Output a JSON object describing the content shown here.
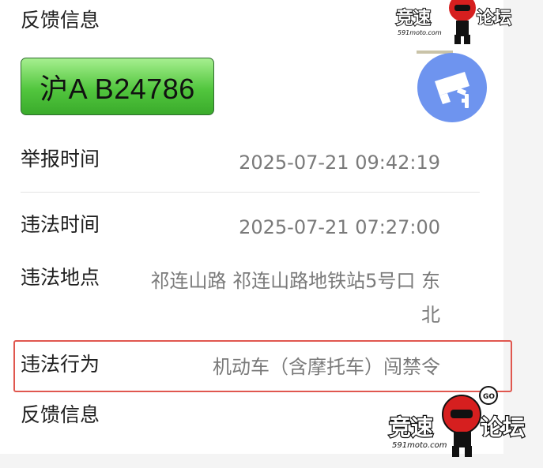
{
  "section_title": "反馈信息",
  "plate": {
    "number": "沪A B24786",
    "color": "#52c63e"
  },
  "camera_icon": {
    "name": "surveillance-camera-icon",
    "color": "#6e94ef"
  },
  "rows": {
    "report_time": {
      "label": "举报时间",
      "value": "2025-07-21 09:42:19"
    },
    "violation_time": {
      "label": "违法时间",
      "value": "2025-07-21 07:27:00"
    },
    "violation_place": {
      "label": "违法地点",
      "value_line1": "祁连山路 祁连山路地铁站5号口 东",
      "value_line2": "北"
    },
    "violation_act": {
      "label": "违法行为",
      "value": "机动车（含摩托车）闯禁令"
    }
  },
  "footer_title": "反馈信息",
  "highlight_color": "#e0574f",
  "watermark": {
    "text": "竞速论坛",
    "url_text": "591moto.com"
  }
}
